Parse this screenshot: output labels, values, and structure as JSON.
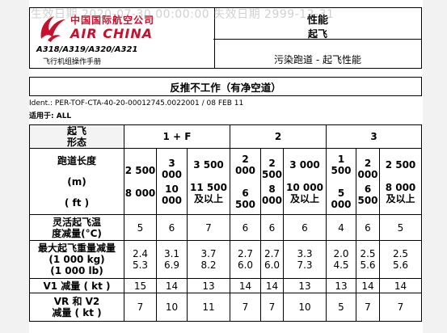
{
  "watermark": "生效日期 2020-07-30 00:00:00 失效日期 2999-12-31",
  "header": {
    "brand_cn": "中国国际航空公司",
    "brand_en": "AIR CHINA",
    "models": "A318/A319/A320/A321",
    "manual": "飞行机组操作手册",
    "section": "性能",
    "subsection": "起飞",
    "topic": "污染跑道 - 起飞性能"
  },
  "title": "反推不工作（有净空道）",
  "ident": "Ident.: PER-TOF-CTA-40-20-00012745.0022001 / 08 FEB 11",
  "applies": "适用于: ALL",
  "table": {
    "flap_label": [
      "起飞",
      "形态"
    ],
    "configs": [
      "1 + F",
      "2",
      "3"
    ],
    "runway_label": [
      "跑道长度",
      "(m)",
      "( ft )"
    ],
    "runway_columns": [
      {
        "m": "2 500",
        "ft": "8 000"
      },
      {
        "m": "3 000",
        "ft": "10 000"
      },
      {
        "m": "3 500",
        "ft": "11 500",
        "note": "及以上"
      },
      {
        "m": "2 000",
        "ft": "6 500"
      },
      {
        "m": "2 500",
        "ft": "8 000"
      },
      {
        "m": "3 000",
        "ft": "10 000",
        "note": "及以上"
      },
      {
        "m": "1 500",
        "ft": "5 000"
      },
      {
        "m": "2 000",
        "ft": "6 500"
      },
      {
        "m": "2 500",
        "ft": "8 000",
        "note": "及以上"
      }
    ],
    "flex_label": [
      "灵活起飞温",
      "度减量(°C)"
    ],
    "flex_values": [
      "5",
      "6",
      "7",
      "6",
      "6",
      "6",
      "4",
      "6",
      "5"
    ],
    "weight_label": [
      "最大起飞重量减量",
      "(1 000 kg)",
      "(1 000 lb)"
    ],
    "weight_kg": [
      "2.4",
      "3.1",
      "3.7",
      "2.7",
      "2.7",
      "3.3",
      "2.0",
      "2.5",
      "2.5"
    ],
    "weight_lb": [
      "5.3",
      "6.9",
      "8.2",
      "6.0",
      "6.0",
      "7.3",
      "4.5",
      "5.6",
      "5.6"
    ],
    "v1_label": "V1 减量 ( kt )",
    "v1_values": [
      "15",
      "14",
      "13",
      "14",
      "14",
      "13",
      "13",
      "14",
      "14"
    ],
    "vr_label": [
      "VR 和 V2",
      "减量 ( kt )"
    ],
    "vr_values": [
      "7",
      "10",
      "11",
      "7",
      "7",
      "10",
      "5",
      "7",
      "7"
    ]
  }
}
